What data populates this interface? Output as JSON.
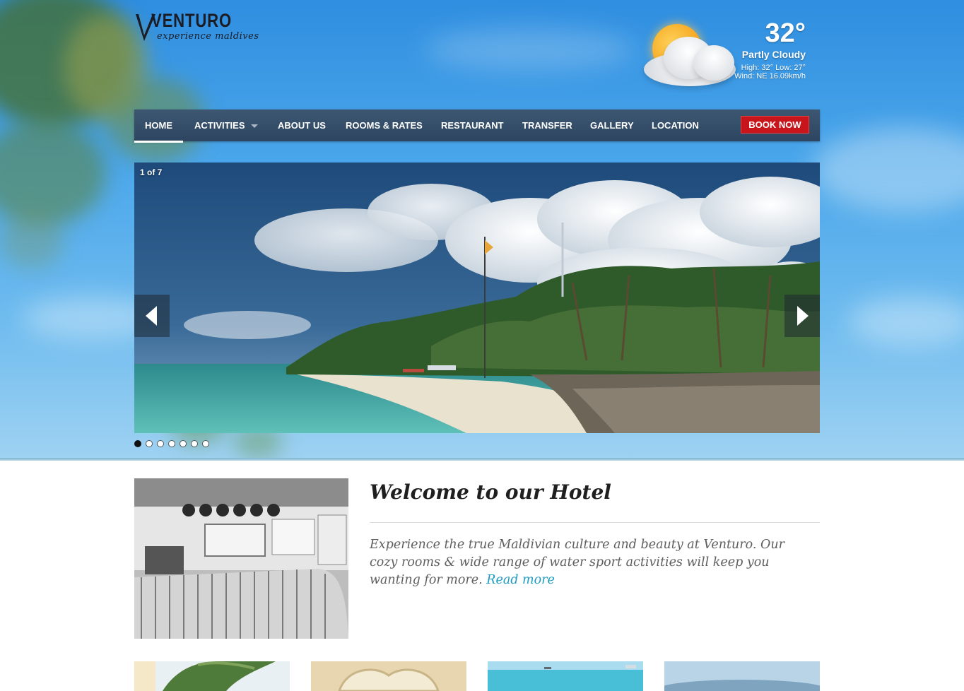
{
  "header": {
    "logo_text": "VENTURO",
    "logo_tagline": "experience maldives"
  },
  "weather": {
    "temperature": "32°",
    "condition": "Partly Cloudy",
    "high_low": "High: 32° Low: 27°",
    "wind": "Wind: NE 16.09km/h",
    "icon": "partly-cloudy-icon"
  },
  "nav": {
    "items": [
      {
        "label": "HOME",
        "active": true
      },
      {
        "label": "ACTIVITIES",
        "has_dropdown": true
      },
      {
        "label": "ABOUT US"
      },
      {
        "label": "ROOMS & RATES"
      },
      {
        "label": "RESTAURANT"
      },
      {
        "label": "TRANSFER"
      },
      {
        "label": "GALLERY"
      },
      {
        "label": "LOCATION"
      }
    ],
    "book_label": "BOOK NOW"
  },
  "slider": {
    "current": 1,
    "total": 7,
    "counter_text": "1 of 7"
  },
  "welcome": {
    "title": "Welcome to our Hotel",
    "body": "Experience the true Maldivian culture and beauty at Venturo. Our cozy rooms & wide range of water sport activities will keep you wanting for more.",
    "read_more": "Read more"
  },
  "colors": {
    "nav_bg": "#34506b",
    "book_button": "#c8151b",
    "link": "#1d9bc0"
  }
}
